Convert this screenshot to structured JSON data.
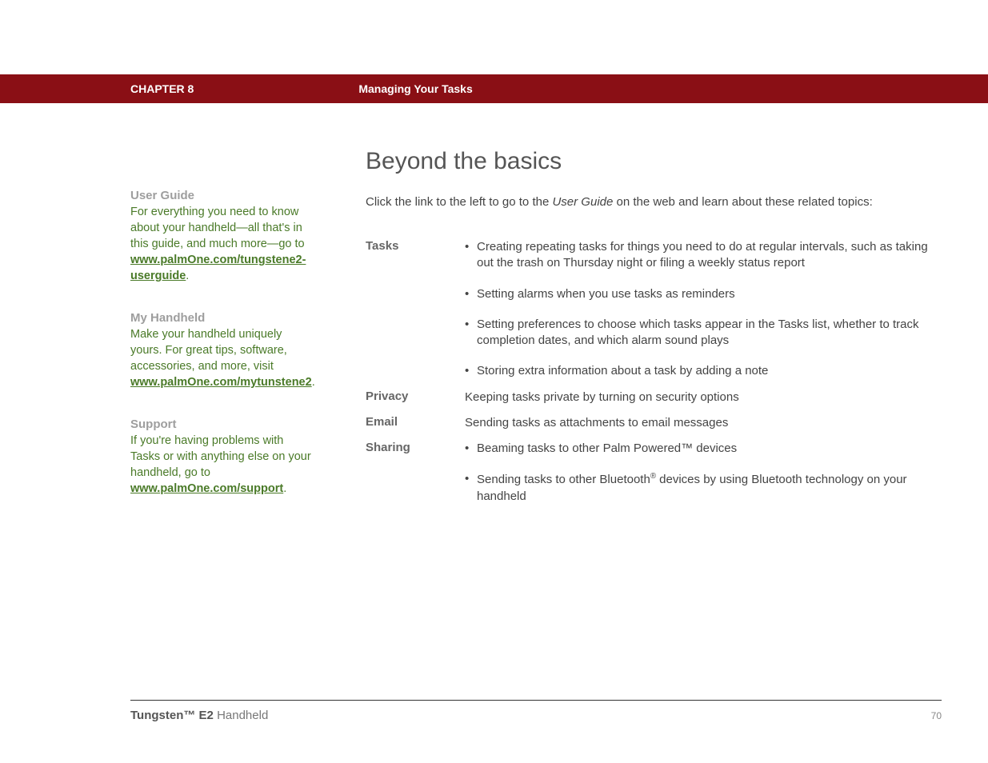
{
  "header": {
    "chapter": "CHAPTER 8",
    "title": "Managing Your Tasks"
  },
  "sidebar": {
    "sections": [
      {
        "heading": "User Guide",
        "text_before": "For everything you need to know about your handheld—all that's in this guide, and much more—go to ",
        "link": "www.palmOne.com/tungstene2-userguide",
        "text_after": "."
      },
      {
        "heading": "My Handheld",
        "text_before": "Make your handheld uniquely yours. For great tips, software, accessories, and more, visit ",
        "link": "www.palmOne.com/mytunstene2",
        "text_after": "."
      },
      {
        "heading": "Support",
        "text_before": "If you're having problems with Tasks or with anything else on your handheld, go to ",
        "link": "www.palmOne.com/support",
        "text_after": "."
      }
    ]
  },
  "main": {
    "heading": "Beyond the basics",
    "intro_before": "Click the link to the left to go to the ",
    "intro_italic": "User Guide",
    "intro_after": " on the web and learn about these related topics:",
    "topics": [
      {
        "label": "Tasks",
        "type": "list",
        "items": [
          "Creating repeating tasks for things you need to do at regular intervals, such as taking out the trash on Thursday night or filing a weekly status report",
          "Setting alarms when you use tasks as reminders",
          "Setting preferences to choose which tasks appear in the Tasks list, whether to track completion dates, and which alarm sound plays",
          "Storing extra information about a task by adding a note"
        ]
      },
      {
        "label": "Privacy",
        "type": "text",
        "content": "Keeping tasks private by turning on security options"
      },
      {
        "label": "Email",
        "type": "text",
        "content": "Sending tasks as attachments to email messages"
      },
      {
        "label": "Sharing",
        "type": "list",
        "items_html": [
          "Beaming tasks to other Palm Powered™ devices",
          "Sending tasks to other Bluetooth<sup>®</sup> devices by using Bluetooth technology on your handheld"
        ]
      }
    ]
  },
  "footer": {
    "product_bold": "Tungsten™ E2",
    "product_rest": " Handheld",
    "page": "70"
  }
}
